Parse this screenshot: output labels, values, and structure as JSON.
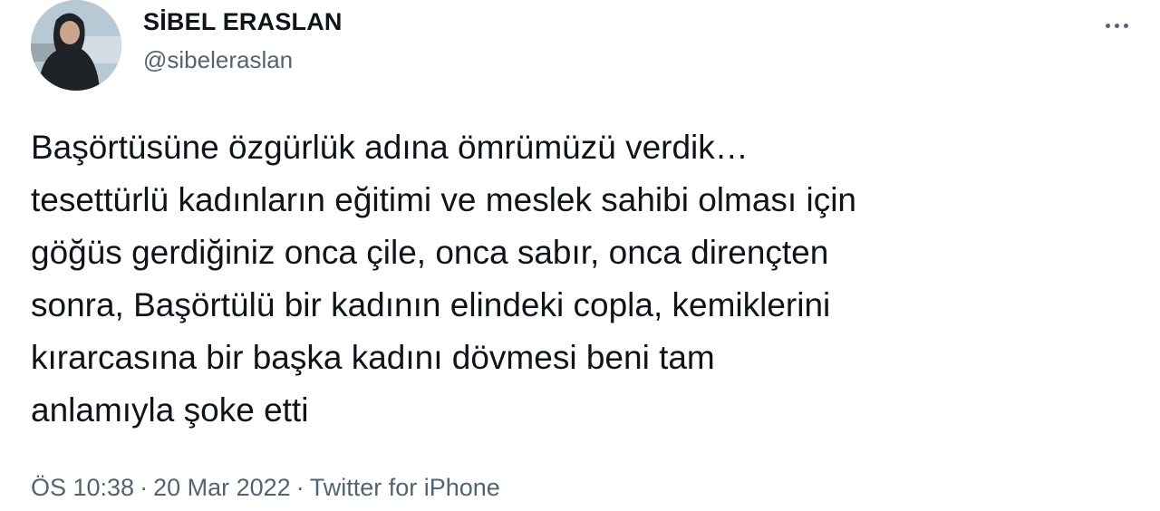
{
  "author": {
    "display_name": "SİBEL ERASLAN",
    "handle": "@sibeleraslan",
    "avatar_icon": "profile-photo"
  },
  "more_icon": "more-options-icon",
  "tweet": {
    "text": "Başörtüsüne özgürlük adına ömrümüzü verdik…\ntesettürlü kadınların eğitimi ve meslek sahibi olması için\ngöğüs gerdiğiniz onca çile, onca sabır, onca dirençten\nsonra, Başörtülü bir kadının elindeki copla, kemiklerini\nkırarcasına bir başka kadını dövmesi beni tam\nanlamıyla şoke etti"
  },
  "meta": {
    "time": "ÖS 10:38",
    "date": "20 Mar 2022",
    "separator": "·",
    "source": "Twitter for iPhone"
  },
  "colors": {
    "text": "#0f1419",
    "secondary": "#536471",
    "background": "#ffffff"
  }
}
